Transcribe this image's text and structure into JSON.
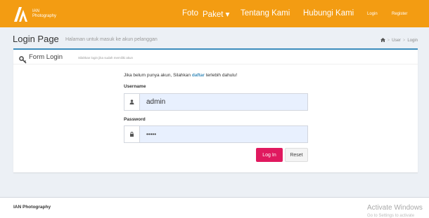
{
  "nav": {
    "brand_line1": "IAN",
    "brand_line2": "Photography",
    "links": [
      "Foto",
      "Paket ▾",
      "Tentang Kami",
      "Hubungi Kami"
    ],
    "login": "Login",
    "register": "Register"
  },
  "header": {
    "title": "Login Page",
    "subtitle": "Halaman untuk masuk ke akun pelanggan",
    "breadcrumb": [
      "User",
      "Login"
    ]
  },
  "box": {
    "title": "Form Login",
    "subtitle": "Silahkan login jika sudah memiliki akun",
    "intro_before": "Jika belum punya akun, Silahkan ",
    "intro_link": "daftar",
    "intro_after": " terlebih dahulu!",
    "username_label": "Username",
    "username_value": "admin",
    "password_label": "Password",
    "password_value": "•••••",
    "login_button": "Log In",
    "reset_button": "Reset"
  },
  "footer": {
    "text": "IAN Photography"
  },
  "watermark": {
    "line1": "Activate Windows",
    "line2": "Go to Settings to activate"
  },
  "colors": {
    "navbar": "#f39c12",
    "accent": "#3c8dbc",
    "login_button": "#e0195f"
  }
}
